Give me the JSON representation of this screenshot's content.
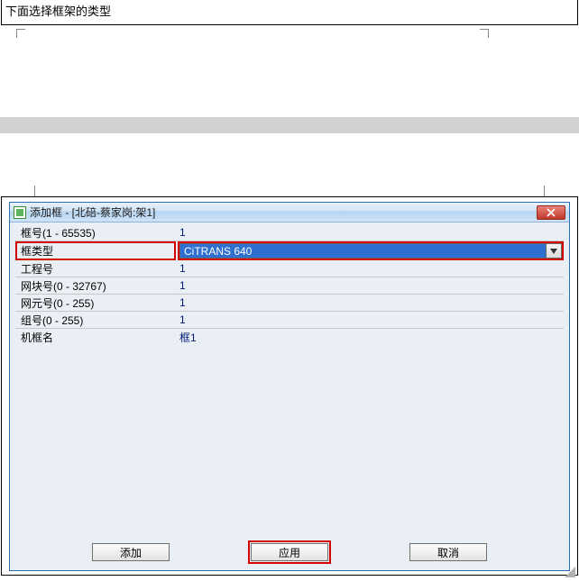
{
  "top_text": "下面选择框架的类型",
  "dialog": {
    "title": "添加框 - [北碚-蔡家岗:架1]",
    "rows": {
      "frame_no": {
        "label": "框号(1 - 65535)",
        "value": "1"
      },
      "frame_type": {
        "label": "框类型",
        "value": "CiTRANS 640"
      },
      "project_no": {
        "label": "工程号",
        "value": "1"
      },
      "block_no": {
        "label": "网块号(0 - 32767)",
        "value": "1"
      },
      "ne_no": {
        "label": "网元号(0 - 255)",
        "value": "1"
      },
      "group_no": {
        "label": "组号(0 - 255)",
        "value": "1"
      },
      "frame_name": {
        "label": "机框名",
        "value": "框1"
      }
    },
    "buttons": {
      "add": "添加",
      "apply": "应用",
      "cancel": "取消"
    }
  }
}
